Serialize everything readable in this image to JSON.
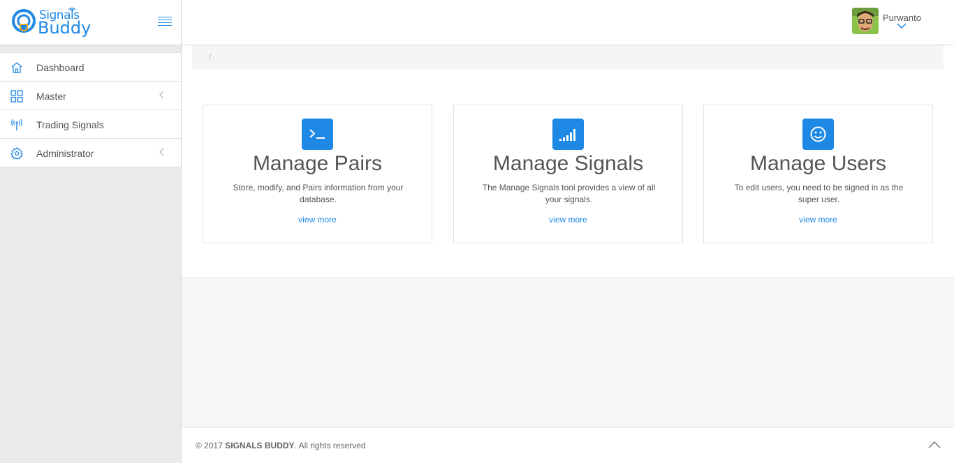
{
  "brand": {
    "line1": "Signals",
    "line2": "Buddy",
    "accent_color": "#1e88e5"
  },
  "header": {
    "user_name": "Purwanto"
  },
  "sidebar": {
    "items": [
      {
        "label": "Dashboard",
        "icon": "home-icon",
        "has_submenu": false
      },
      {
        "label": "Master",
        "icon": "grid-icon",
        "has_submenu": true
      },
      {
        "label": "Trading Signals",
        "icon": "antenna-icon",
        "has_submenu": false
      },
      {
        "label": "Administrator",
        "icon": "gear-icon",
        "has_submenu": true
      }
    ]
  },
  "breadcrumb": {
    "separator": "/"
  },
  "cards": [
    {
      "title": "Manage Pairs",
      "description": "Store, modify, and Pairs information from your database.",
      "link": "view more",
      "icon": "terminal-icon"
    },
    {
      "title": "Manage Signals",
      "description": "The Manage Signals tool provides a view of all your signals.",
      "link": "view more",
      "icon": "signal-bars-icon"
    },
    {
      "title": "Manage Users",
      "description": "To edit users, you need to be signed in as the super user.",
      "link": "view more",
      "icon": "smiley-icon"
    }
  ],
  "footer": {
    "copyright_prefix": "© 2017 ",
    "company": "SIGNALS BUDDY",
    "copyright_suffix": ". All rights reserved"
  }
}
